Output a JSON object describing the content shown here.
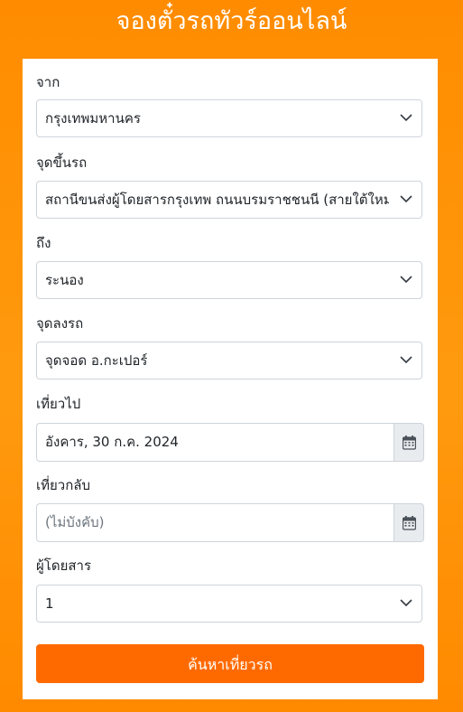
{
  "page": {
    "title": "จองตั๋วรถทัวร์ออนไลน์"
  },
  "form": {
    "from": {
      "label": "จาก",
      "value": "กรุงเทพมหานคร"
    },
    "boarding": {
      "label": "จุดขึ้นรถ",
      "value": "สถานีขนส่งผู้โดยสารกรุงเทพ ถนนบรมราชชนนี (สายใต้ใหม่)"
    },
    "to": {
      "label": "ถึง",
      "value": "ระนอง"
    },
    "dropoff": {
      "label": "จุดลงรถ",
      "value": "จุดจอด อ.กะเปอร์"
    },
    "depart": {
      "label": "เที่ยวไป",
      "value": "อังคาร, 30 ก.ค. 2024"
    },
    "return": {
      "label": "เที่ยวกลับ",
      "placeholder": "(ไม่บังคับ)"
    },
    "passengers": {
      "label": "ผู้โดยสาร",
      "value": "1"
    },
    "search_button": "ค้นหาเที่ยวรถ"
  },
  "colors": {
    "background": "#ff8c00",
    "button": "#ff6a00",
    "addon": "#e9ecef"
  }
}
